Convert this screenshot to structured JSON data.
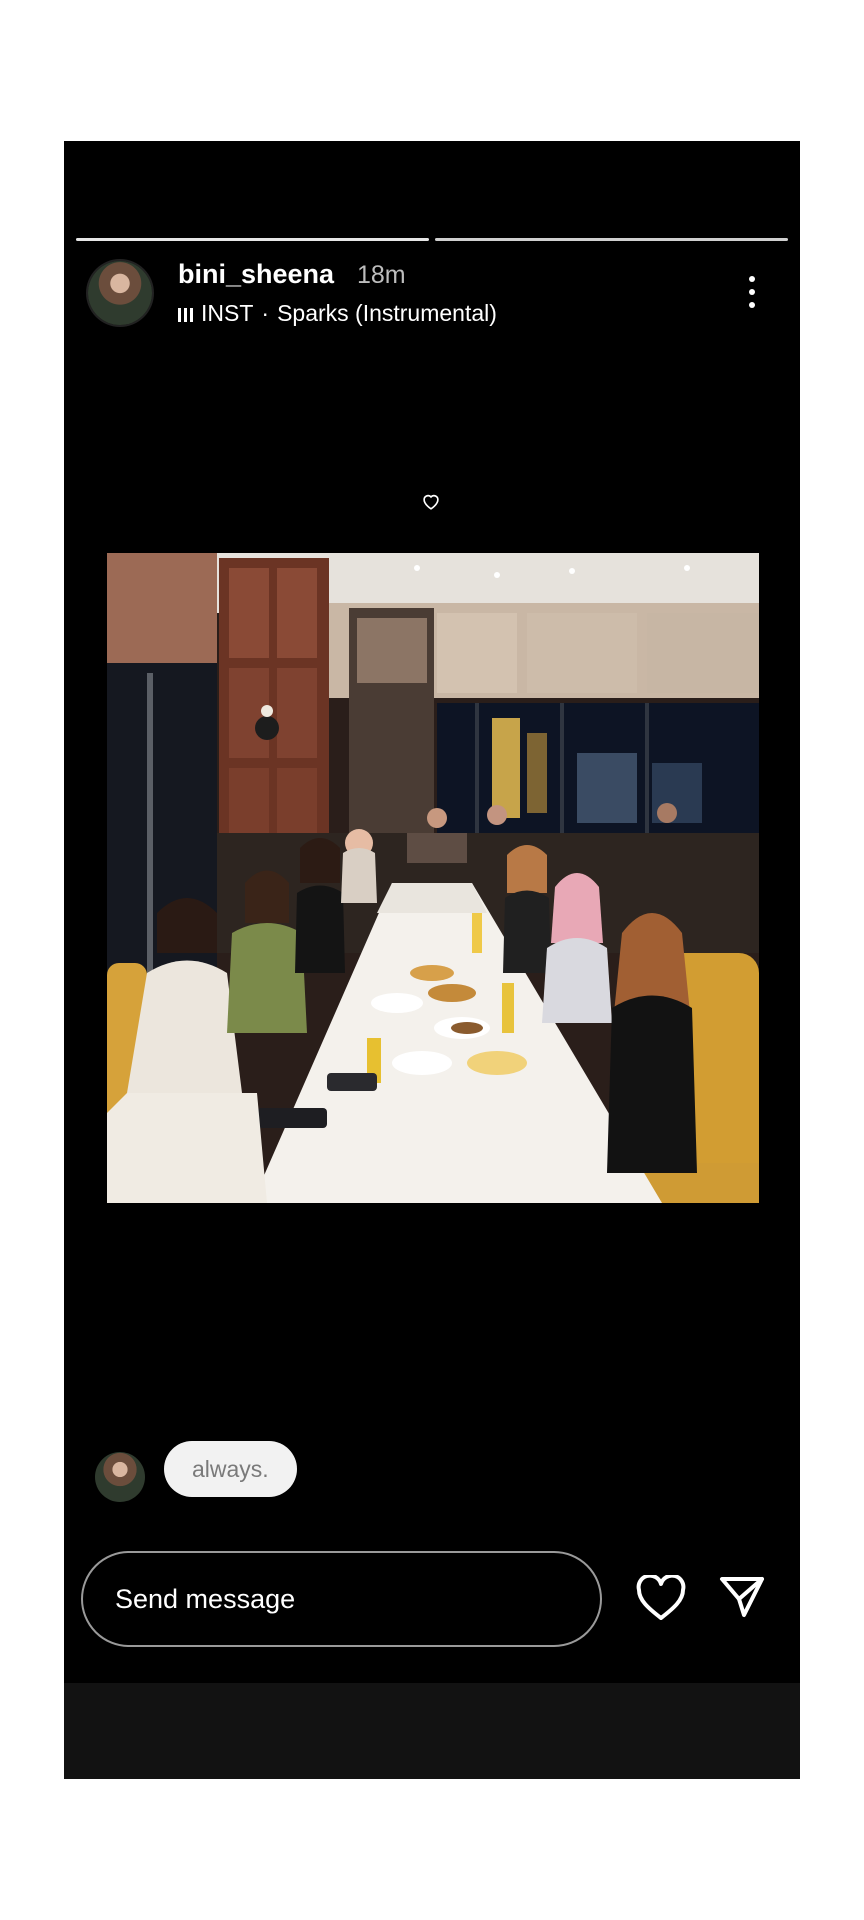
{
  "story": {
    "username": "bini_sheena",
    "time_ago": "18m",
    "music_artist": "INST",
    "music_separator": "·",
    "music_track": "Sparks (Instrumental)",
    "progress": [
      {
        "state": "complete"
      },
      {
        "state": "in-progress"
      }
    ]
  },
  "icons": {
    "music_bars": "music-bars-icon",
    "more": "more-vertical-icon",
    "heart_small": "heart-outline-icon",
    "like": "heart-outline-icon",
    "share": "send-paper-plane-icon"
  },
  "comment": {
    "text": "always."
  },
  "reply": {
    "placeholder": "Send message"
  },
  "colors": {
    "background": "#000000",
    "bubble": "#f2f2f2",
    "progress_active": "#ffffff",
    "progress_inactive": "#8e8e8e"
  }
}
